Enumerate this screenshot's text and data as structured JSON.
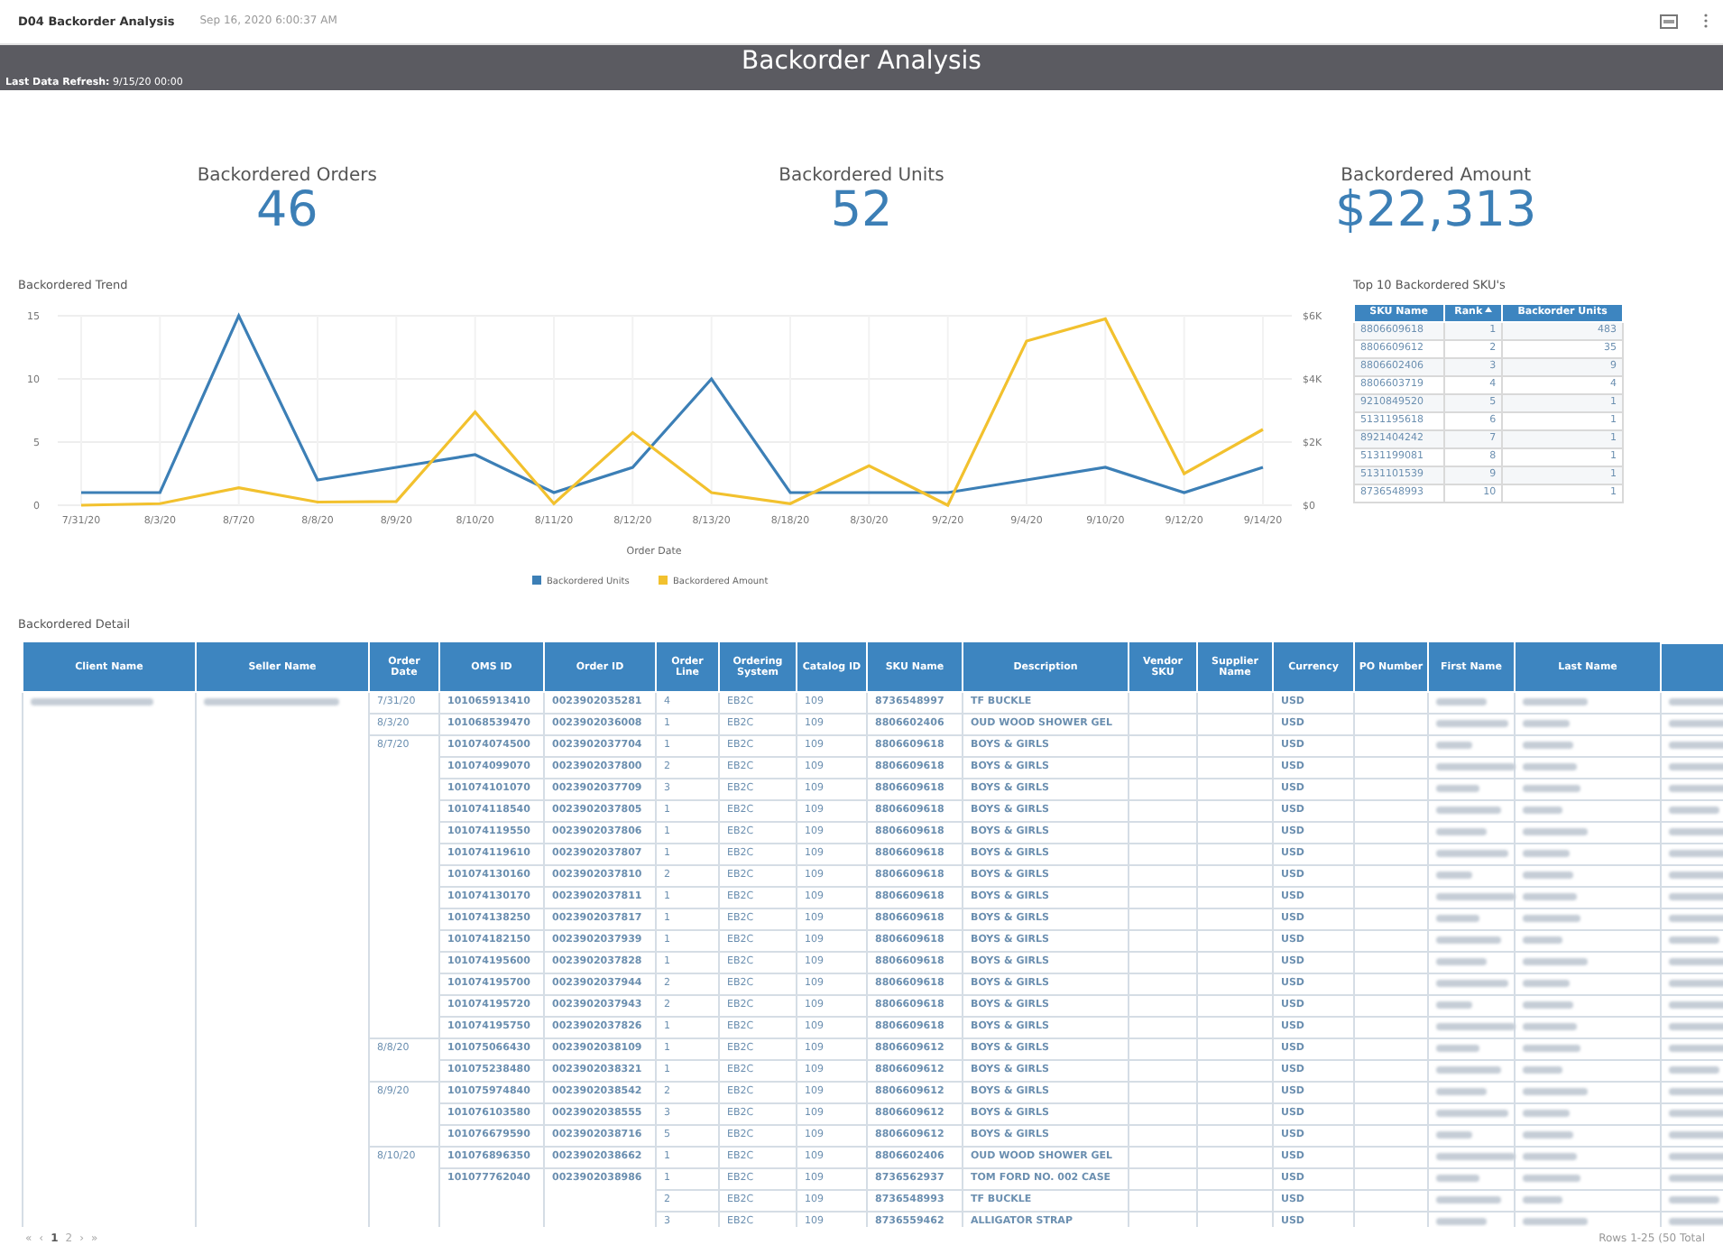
{
  "top_bar": {
    "report_name": "D04 Backorder Analysis",
    "timestamp": "Sep 16, 2020 6:00:37 AM"
  },
  "banner": {
    "title": "Backorder Analysis",
    "refresh": "**Last Data Refresh:** 9/15/20 00:00"
  },
  "kpis": [
    {
      "label": "Backordered Orders",
      "value": "46"
    },
    {
      "label": "Backordered Units",
      "value": "52"
    },
    {
      "label": "Backordered Amount",
      "value": "$22,313"
    }
  ],
  "trend": {
    "title": "Backordered Trend",
    "chart_data": {
      "type": "line",
      "xlabel": "Order Date",
      "categories": [
        "7/31/20",
        "8/3/20",
        "8/7/20",
        "8/8/20",
        "8/9/20",
        "8/10/20",
        "8/11/20",
        "8/12/20",
        "8/13/20",
        "8/18/20",
        "8/30/20",
        "9/2/20",
        "9/4/20",
        "9/10/20",
        "9/12/20",
        "9/14/20"
      ],
      "series": [
        {
          "name": "Backordered Units",
          "color": "#3c7fb6",
          "values": [
            1,
            1,
            15,
            2,
            3,
            4,
            1,
            3,
            10,
            1,
            1,
            1,
            2,
            3,
            1,
            3
          ]
        },
        {
          "name": "Backordered Amount",
          "color": "#f2c12e",
          "axis": "y2",
          "values": [
            0,
            50,
            550,
            100,
            120,
            2950,
            50,
            2300,
            400,
            50,
            1250,
            0,
            5200,
            5900,
            1000,
            2400
          ]
        }
      ],
      "grid": true,
      "legend": "bottom",
      "ylim": [
        0,
        15
      ],
      "y2lim": [
        0,
        6000
      ],
      "yticks": [
        0,
        5,
        10,
        15
      ],
      "y2ticks": [
        {
          "value": 0,
          "label": "$0"
        },
        {
          "value": 2000,
          "label": "$2K"
        },
        {
          "value": 4000,
          "label": "$4K"
        },
        {
          "value": 6000,
          "label": "$6K"
        }
      ]
    }
  },
  "top_skus": {
    "title": "Top 10 Backordered SKU's",
    "columns": [
      "SKU Name",
      "Rank",
      "Backorder Units"
    ],
    "rows": [
      [
        "8806609618",
        "1",
        "483"
      ],
      [
        "8806609612",
        "2",
        "35"
      ],
      [
        "8806602406",
        "3",
        "9"
      ],
      [
        "8806603719",
        "4",
        "4"
      ],
      [
        "9210849520",
        "5",
        "1"
      ],
      [
        "5131195618",
        "6",
        "1"
      ],
      [
        "8921404242",
        "7",
        "1"
      ],
      [
        "5131199081",
        "8",
        "1"
      ],
      [
        "5131101539",
        "9",
        "1"
      ],
      [
        "8736548993",
        "10",
        "1"
      ]
    ]
  },
  "detail": {
    "title": "Backordered Detail",
    "columns": [
      "Client Name",
      "Seller Name",
      "Order Date",
      "OMS ID",
      "Order ID",
      "Order Line",
      "Ordering System",
      "Catalog ID",
      "SKU Name",
      "Description",
      "Vendor SKU",
      "Supplier Name",
      "Currency",
      "PO Number",
      "First Name",
      "Last Name"
    ],
    "rows": [
      {
        "order_date": "7/31/20",
        "oms_id": "101065913410",
        "order_id": "0023902035281",
        "order_line": "4",
        "ordering_system": "EB2C",
        "catalog_id": "109",
        "sku_name": "8736548997",
        "description": "TF BUCKLE",
        "currency": "USD"
      },
      {
        "order_date": "8/3/20",
        "oms_id": "101068539470",
        "order_id": "0023902036008",
        "order_line": "1",
        "ordering_system": "EB2C",
        "catalog_id": "109",
        "sku_name": "8806602406",
        "description": "OUD WOOD SHOWER GEL",
        "currency": "USD"
      },
      {
        "order_date": "8/7/20",
        "oms_id": "101074074500",
        "order_id": "0023902037704",
        "order_line": "1",
        "ordering_system": "EB2C",
        "catalog_id": "109",
        "sku_name": "8806609618",
        "description": "BOYS & GIRLS",
        "currency": "USD"
      },
      {
        "oms_id": "101074099070",
        "order_id": "0023902037800",
        "order_line": "2",
        "ordering_system": "EB2C",
        "catalog_id": "109",
        "sku_name": "8806609618",
        "description": "BOYS & GIRLS",
        "currency": "USD"
      },
      {
        "oms_id": "101074101070",
        "order_id": "0023902037709",
        "order_line": "3",
        "ordering_system": "EB2C",
        "catalog_id": "109",
        "sku_name": "8806609618",
        "description": "BOYS & GIRLS",
        "currency": "USD"
      },
      {
        "oms_id": "101074118540",
        "order_id": "0023902037805",
        "order_line": "1",
        "ordering_system": "EB2C",
        "catalog_id": "109",
        "sku_name": "8806609618",
        "description": "BOYS & GIRLS",
        "currency": "USD"
      },
      {
        "oms_id": "101074119550",
        "order_id": "0023902037806",
        "order_line": "1",
        "ordering_system": "EB2C",
        "catalog_id": "109",
        "sku_name": "8806609618",
        "description": "BOYS & GIRLS",
        "currency": "USD"
      },
      {
        "oms_id": "101074119610",
        "order_id": "0023902037807",
        "order_line": "1",
        "ordering_system": "EB2C",
        "catalog_id": "109",
        "sku_name": "8806609618",
        "description": "BOYS & GIRLS",
        "currency": "USD"
      },
      {
        "oms_id": "101074130160",
        "order_id": "0023902037810",
        "order_line": "2",
        "ordering_system": "EB2C",
        "catalog_id": "109",
        "sku_name": "8806609618",
        "description": "BOYS & GIRLS",
        "currency": "USD"
      },
      {
        "oms_id": "101074130170",
        "order_id": "0023902037811",
        "order_line": "1",
        "ordering_system": "EB2C",
        "catalog_id": "109",
        "sku_name": "8806609618",
        "description": "BOYS & GIRLS",
        "currency": "USD"
      },
      {
        "oms_id": "101074138250",
        "order_id": "0023902037817",
        "order_line": "1",
        "ordering_system": "EB2C",
        "catalog_id": "109",
        "sku_name": "8806609618",
        "description": "BOYS & GIRLS",
        "currency": "USD"
      },
      {
        "oms_id": "101074182150",
        "order_id": "0023902037939",
        "order_line": "1",
        "ordering_system": "EB2C",
        "catalog_id": "109",
        "sku_name": "8806609618",
        "description": "BOYS & GIRLS",
        "currency": "USD"
      },
      {
        "oms_id": "101074195600",
        "order_id": "0023902037828",
        "order_line": "1",
        "ordering_system": "EB2C",
        "catalog_id": "109",
        "sku_name": "8806609618",
        "description": "BOYS & GIRLS",
        "currency": "USD"
      },
      {
        "oms_id": "101074195700",
        "order_id": "0023902037944",
        "order_line": "2",
        "ordering_system": "EB2C",
        "catalog_id": "109",
        "sku_name": "8806609618",
        "description": "BOYS & GIRLS",
        "currency": "USD"
      },
      {
        "oms_id": "101074195720",
        "order_id": "0023902037943",
        "order_line": "2",
        "ordering_system": "EB2C",
        "catalog_id": "109",
        "sku_name": "8806609618",
        "description": "BOYS & GIRLS",
        "currency": "USD"
      },
      {
        "oms_id": "101074195750",
        "order_id": "0023902037826",
        "order_line": "1",
        "ordering_system": "EB2C",
        "catalog_id": "109",
        "sku_name": "8806609618",
        "description": "BOYS & GIRLS",
        "currency": "USD"
      },
      {
        "order_date": "8/8/20",
        "oms_id": "101075066430",
        "order_id": "0023902038109",
        "order_line": "1",
        "ordering_system": "EB2C",
        "catalog_id": "109",
        "sku_name": "8806609612",
        "description": "BOYS & GIRLS",
        "currency": "USD"
      },
      {
        "oms_id": "101075238480",
        "order_id": "0023902038321",
        "order_line": "1",
        "ordering_system": "EB2C",
        "catalog_id": "109",
        "sku_name": "8806609612",
        "description": "BOYS & GIRLS",
        "currency": "USD"
      },
      {
        "order_date": "8/9/20",
        "oms_id": "101075974840",
        "order_id": "0023902038542",
        "order_line": "2",
        "ordering_system": "EB2C",
        "catalog_id": "109",
        "sku_name": "8806609612",
        "description": "BOYS & GIRLS",
        "currency": "USD"
      },
      {
        "oms_id": "101076103580",
        "order_id": "0023902038555",
        "order_line": "3",
        "ordering_system": "EB2C",
        "catalog_id": "109",
        "sku_name": "8806609612",
        "description": "BOYS & GIRLS",
        "currency": "USD"
      },
      {
        "oms_id": "101076679590",
        "order_id": "0023902038716",
        "order_line": "5",
        "ordering_system": "EB2C",
        "catalog_id": "109",
        "sku_name": "8806609612",
        "description": "BOYS & GIRLS",
        "currency": "USD"
      },
      {
        "order_date": "8/10/20",
        "oms_id": "101076896350",
        "order_id": "0023902038662",
        "order_line": "1",
        "ordering_system": "EB2C",
        "catalog_id": "109",
        "sku_name": "8806602406",
        "description": "OUD WOOD SHOWER GEL",
        "currency": "USD"
      },
      {
        "oms_id": "101077762040",
        "order_id": "0023902038986",
        "order_line": "1",
        "ordering_system": "EB2C",
        "catalog_id": "109",
        "sku_name": "8736562937",
        "description": "TOM FORD NO. 002 CASE",
        "currency": "USD"
      },
      {
        "order_line": "2",
        "ordering_system": "EB2C",
        "catalog_id": "109",
        "sku_name": "8736548993",
        "description": "TF BUCKLE",
        "currency": "USD"
      },
      {
        "order_line": "3",
        "ordering_system": "EB2C",
        "catalog_id": "109",
        "sku_name": "8736559462",
        "description": "ALLIGATOR STRAP",
        "currency": "USD"
      }
    ]
  },
  "pager": {
    "first": "«",
    "prev": "‹",
    "pages": [
      {
        "label": "1",
        "selected": true
      },
      {
        "label": "2",
        "selected": false
      }
    ],
    "next": "›",
    "last": "»",
    "summary": "Rows 1-25 (50 Total"
  }
}
